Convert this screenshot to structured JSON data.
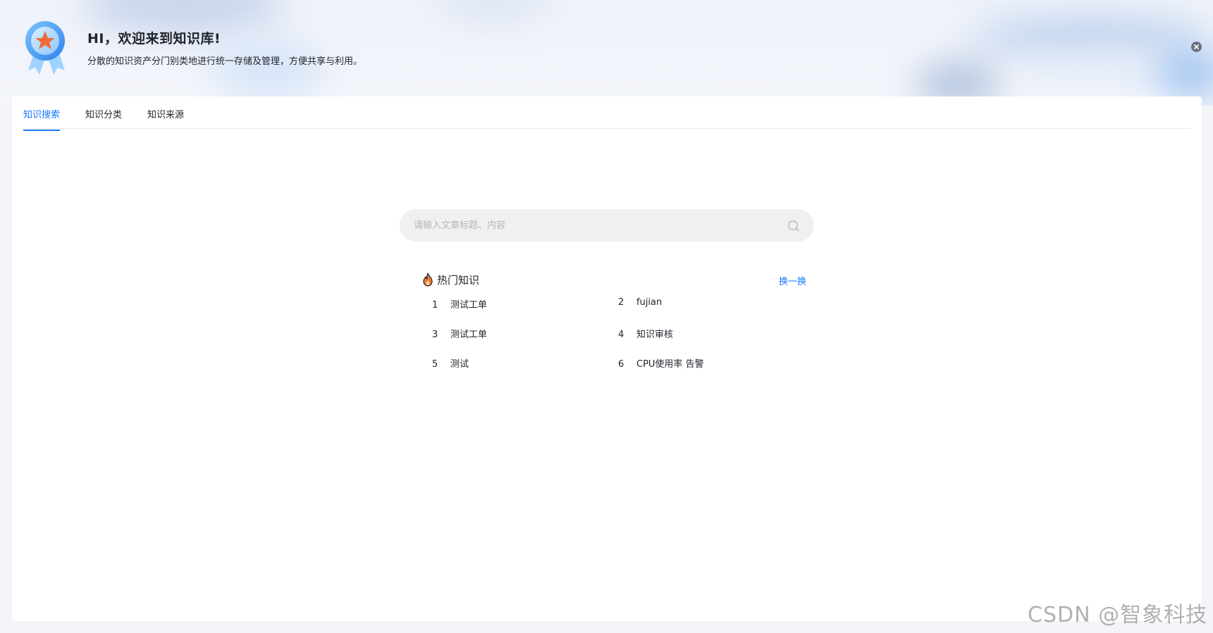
{
  "banner": {
    "title": "HI，欢迎来到知识库!",
    "subtitle": "分散的知识资产分门别类地进行统一存储及管理，方便共享与利用。",
    "icons": {
      "medal": "medal-star-icon",
      "close": "close-circle-icon"
    }
  },
  "tabs": [
    {
      "label": "知识搜索",
      "active": true
    },
    {
      "label": "知识分类",
      "active": false
    },
    {
      "label": "知识来源",
      "active": false
    }
  ],
  "search": {
    "placeholder": "请输入文章标题、内容",
    "value": "",
    "icon": "search-icon"
  },
  "hot": {
    "title": "热门知识",
    "icon": "fire-icon",
    "refresh_label": "换一换",
    "items": [
      {
        "rank": "1",
        "title": "测试工单"
      },
      {
        "rank": "2",
        "title": "fujian"
      },
      {
        "rank": "3",
        "title": "测试工单"
      },
      {
        "rank": "4",
        "title": "知识审核"
      },
      {
        "rank": "5",
        "title": "测试"
      },
      {
        "rank": "6",
        "title": "CPU使用率 告警"
      }
    ]
  },
  "colors": {
    "accent": "#1677ff",
    "fire": "#f07a3c",
    "text": "#1f2329",
    "search_bg": "#f0f0f1",
    "page_bg": "#f3f4f8"
  },
  "watermark": "CSDN @智象科技"
}
